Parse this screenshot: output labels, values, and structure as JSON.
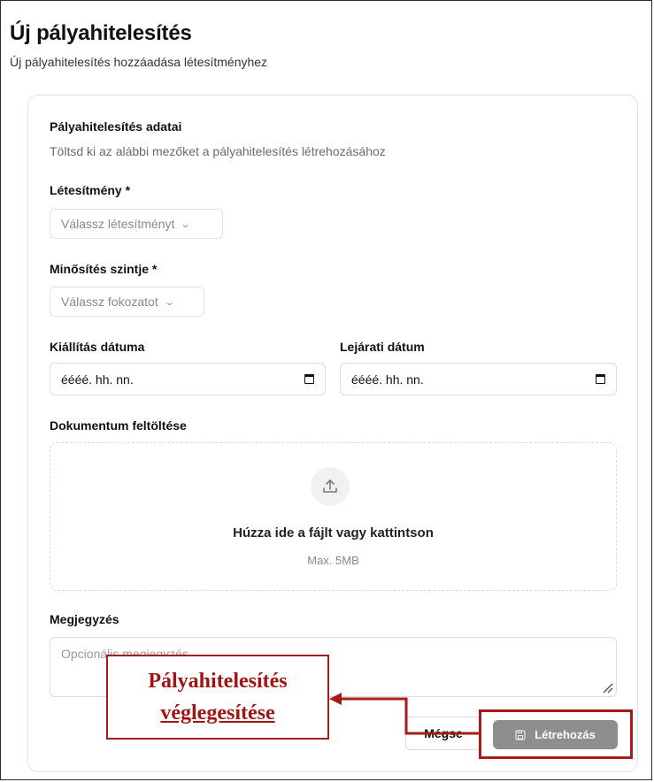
{
  "header": {
    "title": "Új pályahitelesítés",
    "subtitle": "Új pályahitelesítés hozzáadása létesítményhez"
  },
  "section": {
    "title": "Pályahitelesítés adatai",
    "description": "Töltsd ki az alábbi mezőket a pályahitelesítés létrehozásához"
  },
  "facility": {
    "label": "Létesítmény *",
    "placeholder": "Válassz létesítményt"
  },
  "level": {
    "label": "Minősítés szintje *",
    "placeholder": "Válassz fokozatot"
  },
  "issue_date": {
    "label": "Kiállítás dátuma",
    "value": "éééé. hh. nn."
  },
  "expiry_date": {
    "label": "Lejárati dátum",
    "value": "éééé. hh. nn."
  },
  "upload": {
    "label": "Dokumentum feltöltése",
    "prompt": "Húzza ide a fájlt vagy kattintson",
    "limit": "Max. 5MB"
  },
  "note": {
    "label": "Megjegyzés",
    "placeholder": "Opcionális megjegyzés..."
  },
  "actions": {
    "cancel": "Mégse",
    "create": "Létrehozás"
  },
  "annotation": {
    "line1": "Pályahitelesítés",
    "line2": "véglegesítése",
    "color": "#a61c1c"
  },
  "icons": {
    "select_chevron": "chevron-down-icon",
    "calendar": "calendar-icon",
    "upload": "upload-icon",
    "save": "save-icon"
  },
  "colors": {
    "create_button_bg": "#8e8e8e",
    "annotation": "#a61c1c"
  }
}
